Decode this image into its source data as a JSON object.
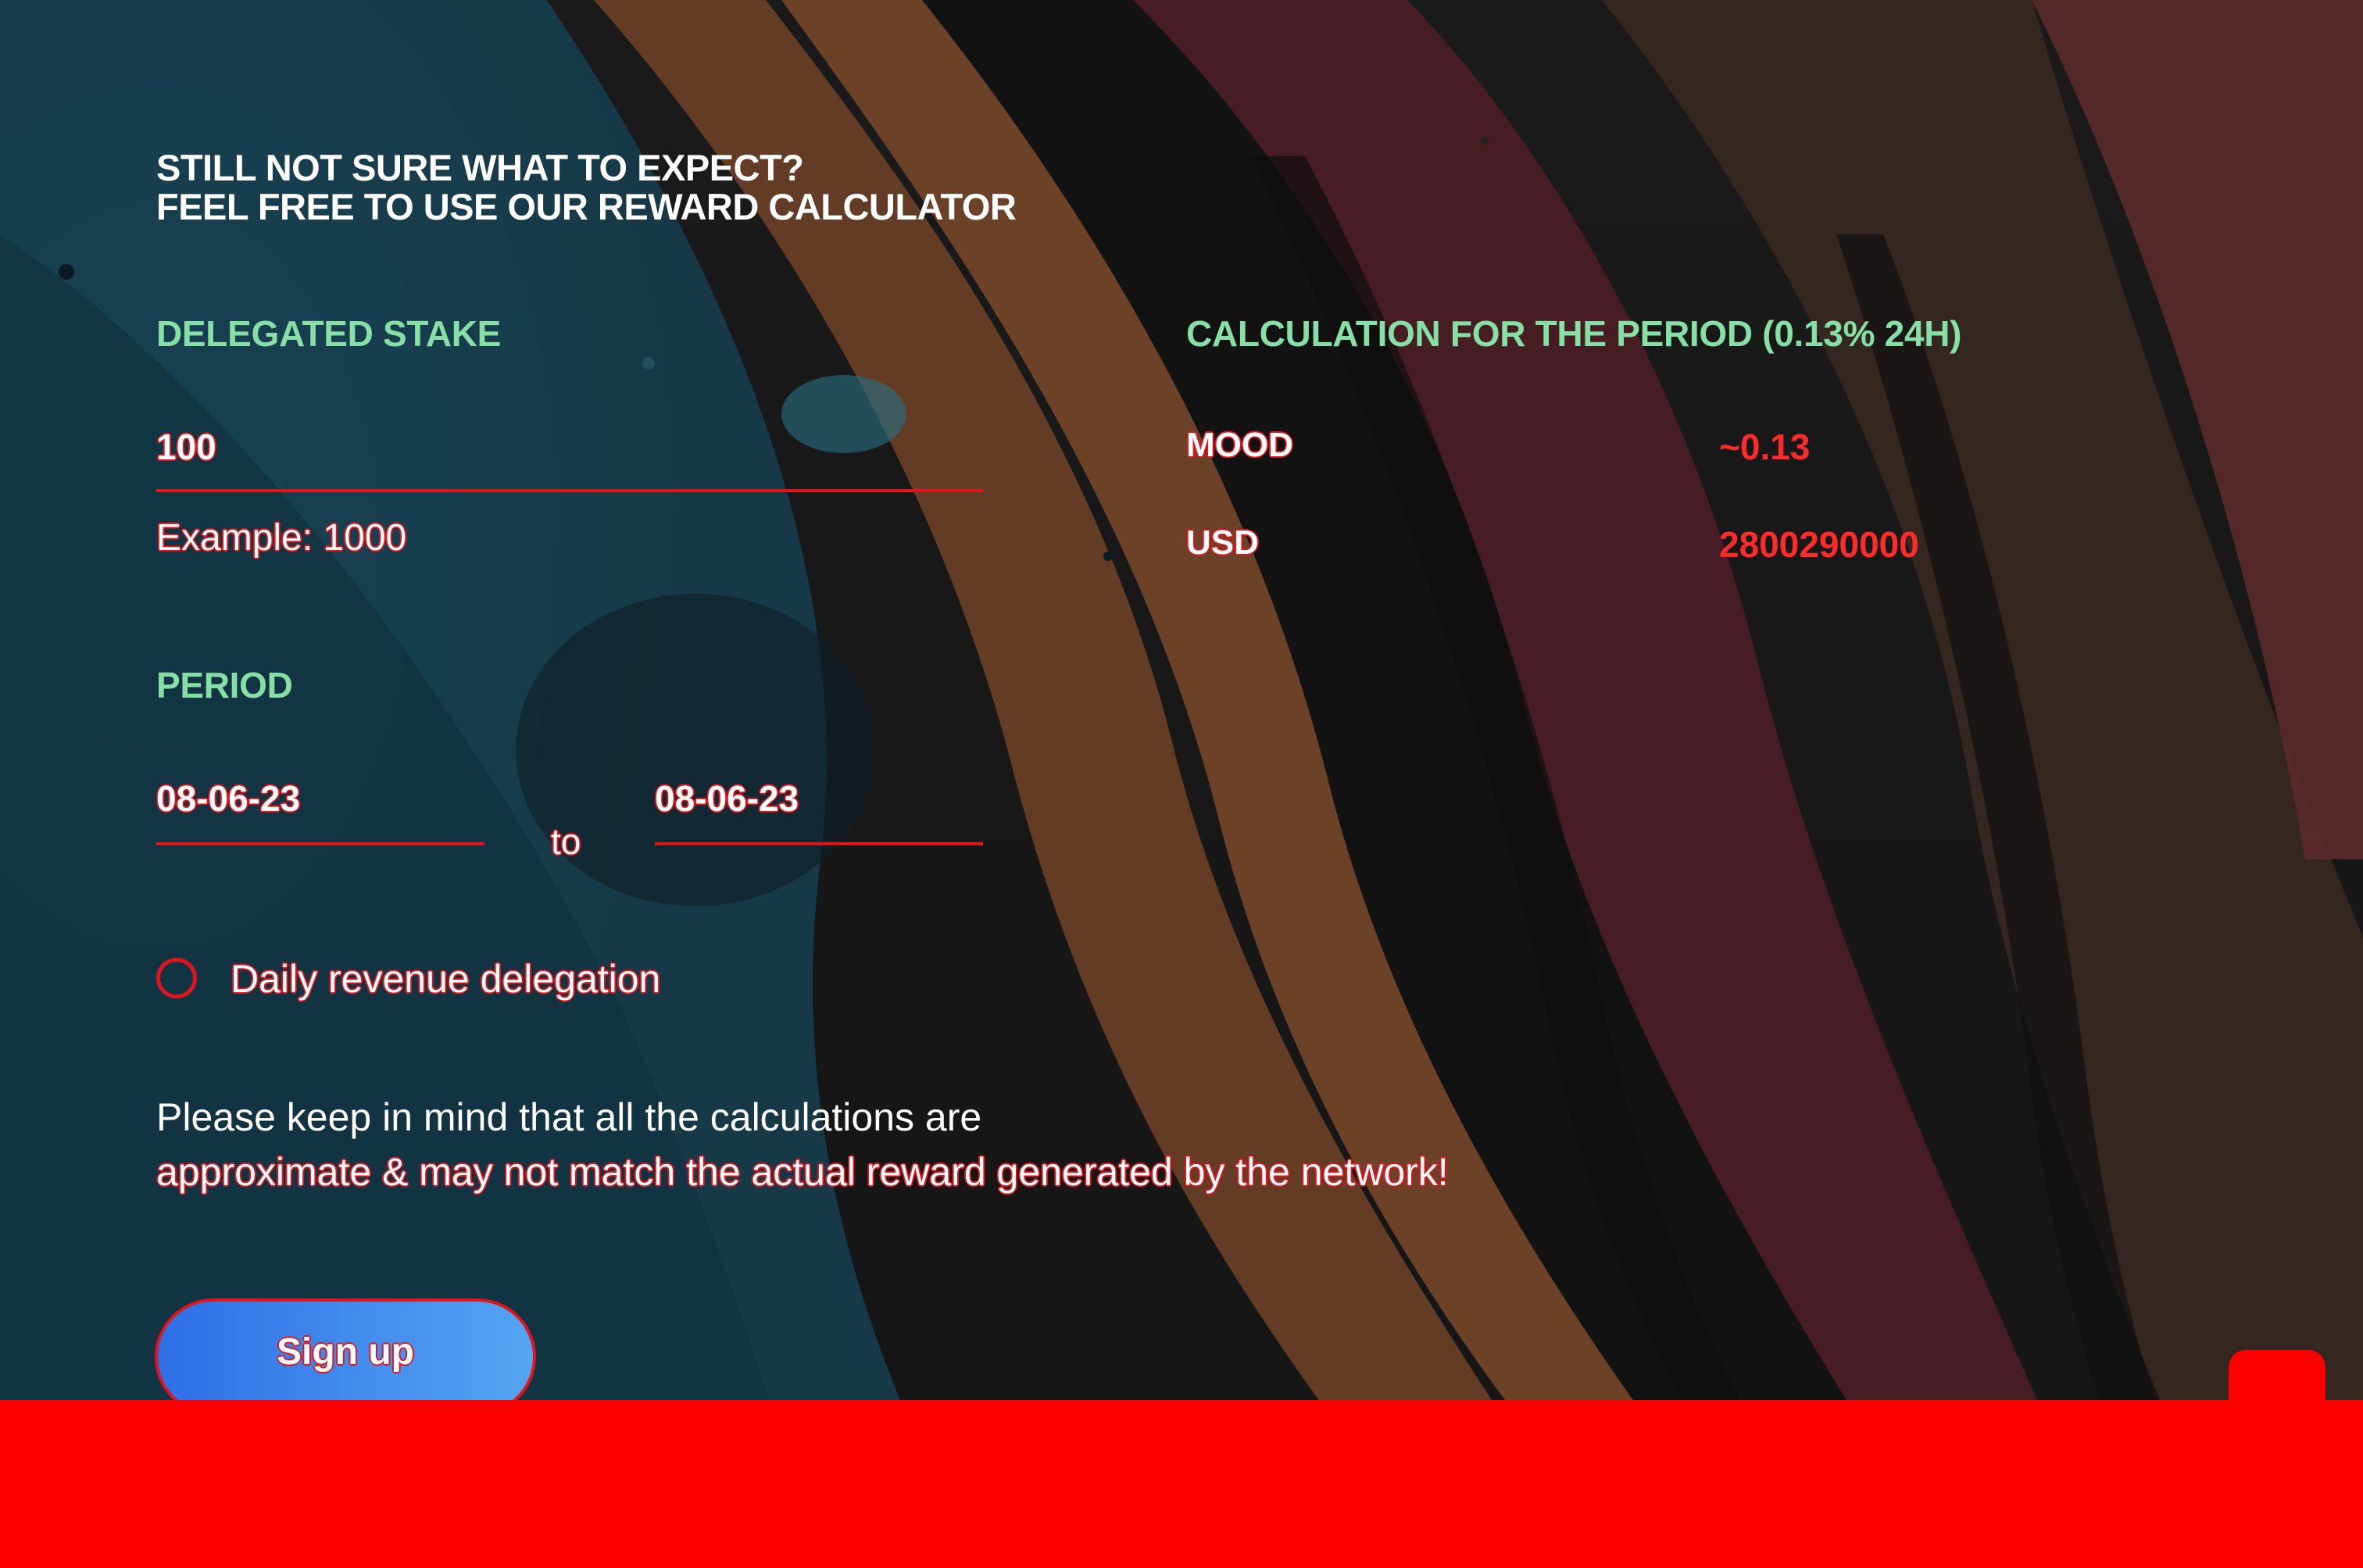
{
  "headline": {
    "line1": "STILL NOT SURE WHAT TO EXPECT?",
    "line2": "FEEL FREE TO USE OUR REWARD CALCULATOR"
  },
  "stake": {
    "label": "DELEGATED STAKE",
    "value": "100",
    "example": "Example: 1000"
  },
  "period": {
    "label": "PERIOD",
    "from": "08-06-23",
    "to_word": "to",
    "to": "08-06-23"
  },
  "calculation": {
    "label": "CALCULATION FOR THE PERIOD (0.13% 24H)",
    "rows": [
      {
        "label": "MOOD",
        "value": "~0.13"
      },
      {
        "label": "USD",
        "value": "2800290000"
      }
    ]
  },
  "daily_revenue": {
    "label": "Daily revenue delegation",
    "checked": false
  },
  "disclaimer": {
    "line1": "Please keep in mind that all the calculations are",
    "line2": "approximate & may not match the actual reward generated by the network!"
  },
  "signup": {
    "label": "Sign up"
  },
  "colors": {
    "accent_green": "#86e0a6",
    "accent_red": "#e0151b",
    "footer_red": "#ff0000",
    "button_gradient_start": "#2f6fe6",
    "button_gradient_end": "#55a4f2"
  }
}
